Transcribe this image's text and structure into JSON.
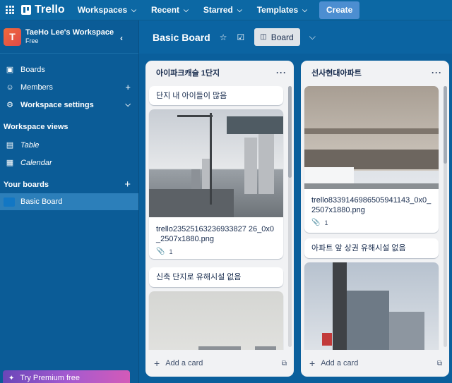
{
  "topbar": {
    "app_name": "Trello",
    "nav": [
      "Workspaces",
      "Recent",
      "Starred",
      "Templates"
    ],
    "create_label": "Create"
  },
  "sidebar": {
    "workspace_initial": "T",
    "workspace_name": "TaeHo Lee's Workspace",
    "workspace_plan": "Free",
    "items": [
      {
        "label": "Boards",
        "icon": "board-icon"
      },
      {
        "label": "Members",
        "icon": "person-icon"
      },
      {
        "label": "Workspace settings",
        "icon": "gear-icon"
      }
    ],
    "views_heading": "Workspace views",
    "views": [
      {
        "label": "Table",
        "icon": "table-icon"
      },
      {
        "label": "Calendar",
        "icon": "calendar-icon"
      }
    ],
    "boards_heading": "Your boards",
    "boards": [
      {
        "label": "Basic Board",
        "color": "#1277c4"
      }
    ],
    "premium_label": "Try Premium free"
  },
  "board": {
    "title": "Basic Board",
    "view_label": "Board"
  },
  "lists": [
    {
      "title": "아이파크캐슬 1단지",
      "cards": [
        {
          "type": "text",
          "text": "단지 내 아이들이 많음"
        },
        {
          "type": "image",
          "filename": "trello23525163236933827 26_0x0_2507x1880.png",
          "attachments": "1"
        },
        {
          "type": "text",
          "text": "신축 단지로 유해시설 없음"
        },
        {
          "type": "image",
          "filename": "",
          "attachments": ""
        }
      ],
      "add_label": "Add a card"
    },
    {
      "title": "선사현대아파트",
      "cards": [
        {
          "type": "image",
          "filename": "trello8339146986505941143_0x0_2507x1880.png",
          "attachments": "1"
        },
        {
          "type": "text",
          "text": "아파트 앞 상권 유해시설 없음"
        },
        {
          "type": "image",
          "filename": "",
          "attachments": ""
        }
      ],
      "add_label": "Add a card"
    }
  ],
  "colors": {
    "topbar": "#0c68a4",
    "sidebar": "#0b5c97",
    "board_bg": "#0a5f9c",
    "list_bg": "#f1f2f4",
    "accent": "#4c8ed1"
  }
}
